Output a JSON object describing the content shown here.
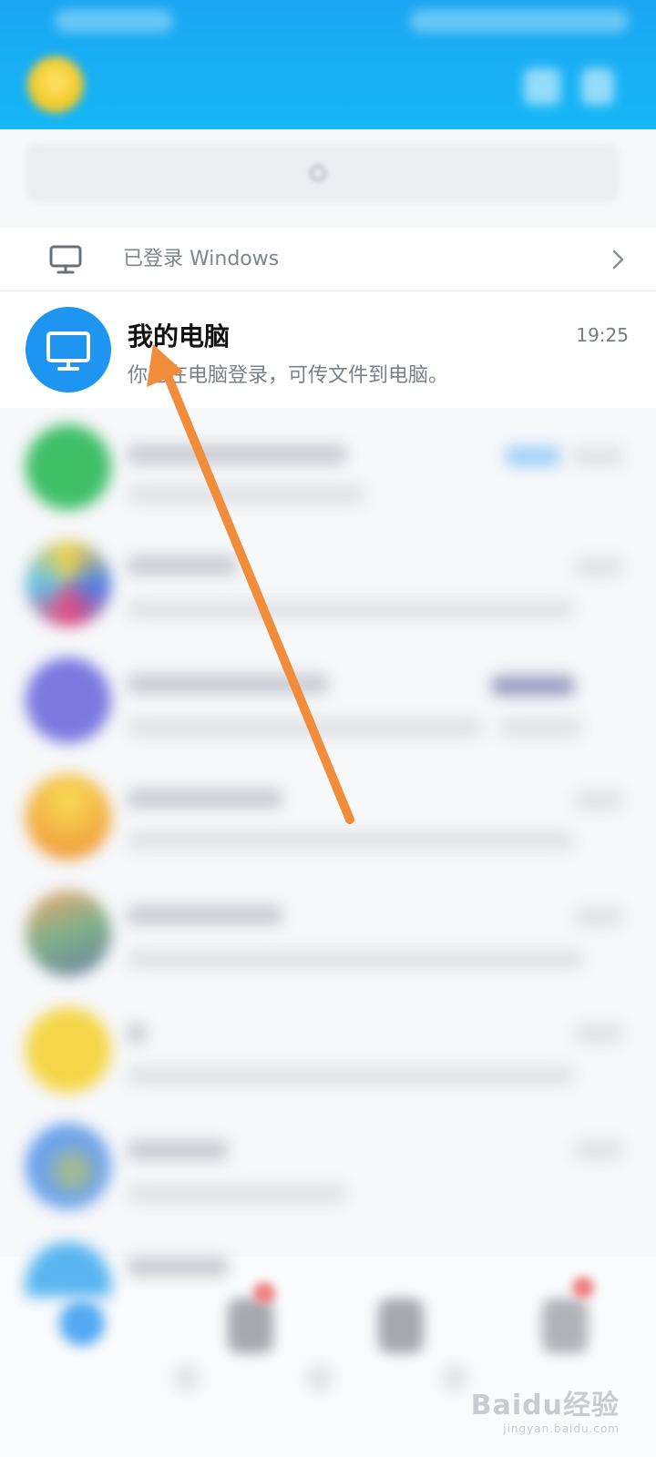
{
  "colors": {
    "header": "#1aa6f2",
    "accent": "#1e95f0",
    "arrow": "#f08c3a"
  },
  "search": {
    "icon": "search-icon"
  },
  "logged_in_banner": {
    "icon": "monitor-icon",
    "label": "已登录 Windows",
    "chevron": "chevron-right-icon"
  },
  "conversations": [
    {
      "title": "我的电脑",
      "message": "你已在电脑登录，可传文件到电脑。",
      "time": "19:25",
      "avatar_icon": "monitor-icon"
    }
  ],
  "annotation": {
    "type": "arrow",
    "color": "#f08c3a"
  },
  "watermark": {
    "main": "Baidu经验",
    "sub": "jingyan.baidu.com"
  }
}
